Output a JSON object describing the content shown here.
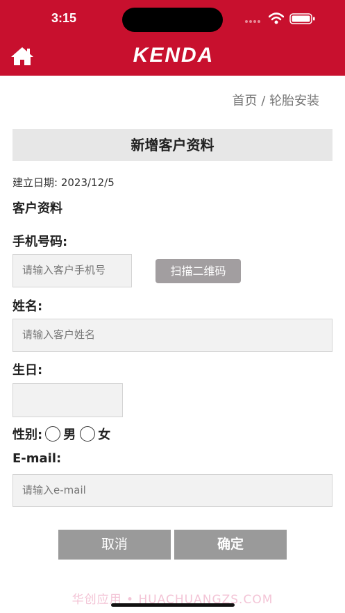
{
  "status_bar": {
    "time": "3:15"
  },
  "header": {
    "brand": "KENDA"
  },
  "breadcrumb": "首页 / 轮胎安装",
  "form": {
    "title": "新增客户资料",
    "created_date": "建立日期: 2023/12/5",
    "section_title": "客户资料",
    "phone_label": "手机号码:",
    "phone_placeholder": "请输入客户手机号",
    "scan_button": "扫描二维码",
    "name_label": "姓名:",
    "name_placeholder": "请输入客户姓名",
    "birthday_label": "生日:",
    "gender_label": "性别:",
    "gender_options": [
      "男",
      "女"
    ],
    "email_label": "E-mail:",
    "email_placeholder": "请输入e-mail"
  },
  "actions": {
    "cancel": "取消",
    "confirm": "确定"
  },
  "watermark": "华创应用 • HUACHUANGZS.COM",
  "colors": {
    "brand_red": "#c8102e",
    "button_gray": "#9a9a9a",
    "scan_gray": "#a29ea0"
  }
}
